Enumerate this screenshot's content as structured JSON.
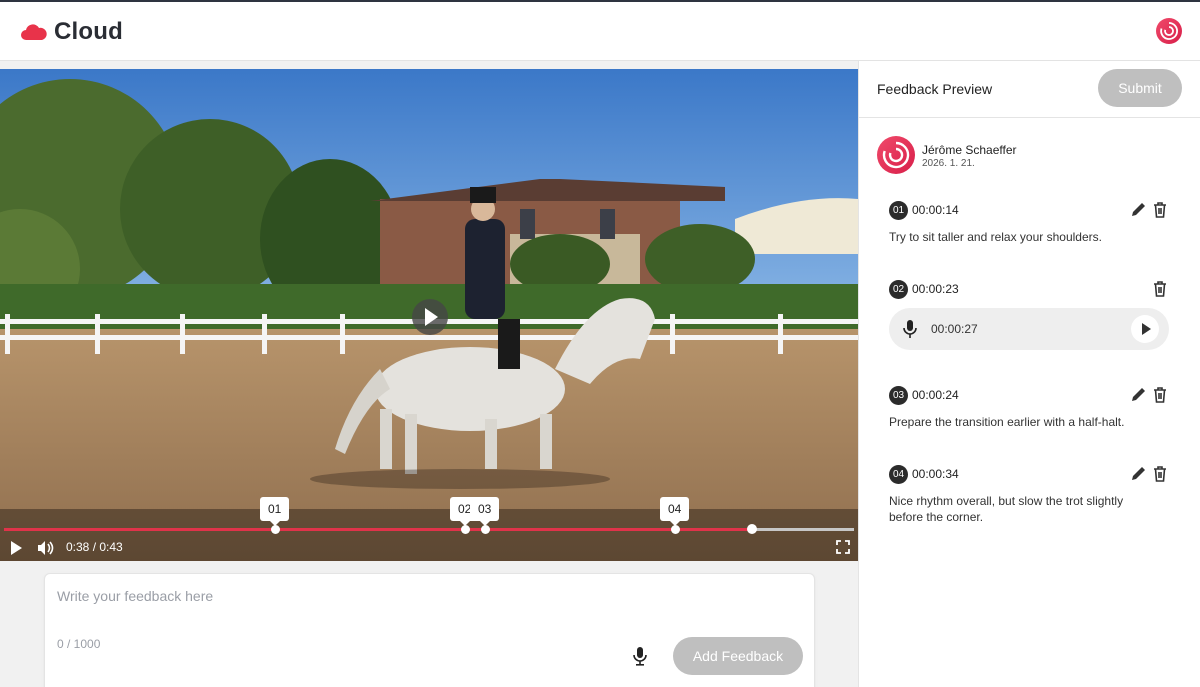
{
  "header": {
    "brand": "Cloud",
    "brand_color": "#e8334a",
    "logo_icon": "cloud-icon",
    "profile_icon": "swirl-logo-icon"
  },
  "video": {
    "current_time": "0:38",
    "duration": "0:43",
    "time_display": "0:38 / 0:43",
    "progress_fraction": 0.88,
    "markers": [
      {
        "label": "01",
        "fraction": 0.32
      },
      {
        "label": "02",
        "fraction": 0.54
      },
      {
        "label": "03",
        "fraction": 0.57
      },
      {
        "label": "04",
        "fraction": 0.79
      }
    ]
  },
  "input": {
    "placeholder": "Write your feedback here",
    "char_count": "0 / 1000",
    "add_button": "Add Feedback"
  },
  "panel": {
    "title": "Feedback Preview",
    "submit_button": "Submit",
    "reviewer": {
      "name": "Jérôme Schaeffer",
      "date": "2026. 1. 21."
    },
    "items": [
      {
        "number": "01",
        "time": "00:00:14",
        "type": "text",
        "text": "Try to sit taller and relax your shoulders."
      },
      {
        "number": "02",
        "time": "00:00:23",
        "type": "audio",
        "audio_length": "00:00:27"
      },
      {
        "number": "03",
        "time": "00:00:24",
        "type": "text",
        "text": "Prepare the transition earlier with a half-halt."
      },
      {
        "number": "04",
        "time": "00:00:34",
        "type": "text",
        "text": "Nice rhythm overall, but slow the trot slightly before the corner."
      }
    ]
  }
}
